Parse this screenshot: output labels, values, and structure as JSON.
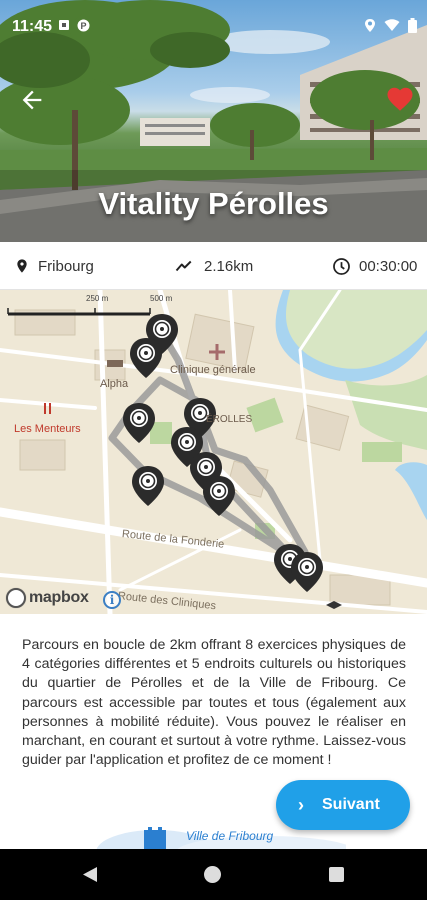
{
  "status_bar": {
    "time": "11:45",
    "icons_left": [
      "sim-icon",
      "app-icon"
    ],
    "icons_right": [
      "location-icon",
      "wifi-icon",
      "battery-icon"
    ]
  },
  "hero": {
    "title": "Vitality Pérolles",
    "back_icon": "arrow-left-icon",
    "favorite_icon": "heart-icon",
    "favorite_color": "#e53935"
  },
  "info": {
    "location": "Fribourg",
    "distance": "2.16km",
    "duration": "00:30:00"
  },
  "map": {
    "scale_labels": [
      "250 m",
      "500 m"
    ],
    "labels": {
      "alpha": "Alpha",
      "clinique": "Clinique générale",
      "les_menteurs": "Les Menteurs",
      "route": "Route de la Fonderie",
      "route2": "Route des Cliniques",
      "perolles_partial": "ÉROLLES"
    },
    "attribution": "mapbox",
    "route_color": "#9a9a9a",
    "marker_color": "#2b2b2b",
    "marker_count": 10
  },
  "description": "Parcours en boucle de 2km offrant 8 exercices physiques de 4 catégories différentes et 5 endroits culturels ou historiques du quartier de Pérolles et de la Ville de Fribourg. Ce parcours est accessible par toutes et tous (également aux personnes à mobilité réduite). Vous pouvez le réaliser en marchant, en courant et surtout à votre rythme. Laissez-vous guider par l'application et profitez de ce moment !",
  "footer": {
    "logo_text": "Ville de Fribourg"
  },
  "next_button": {
    "label": "Suivant",
    "color": "#20a0e8"
  },
  "nav_bar": {
    "items": [
      "back",
      "home",
      "recents"
    ]
  }
}
